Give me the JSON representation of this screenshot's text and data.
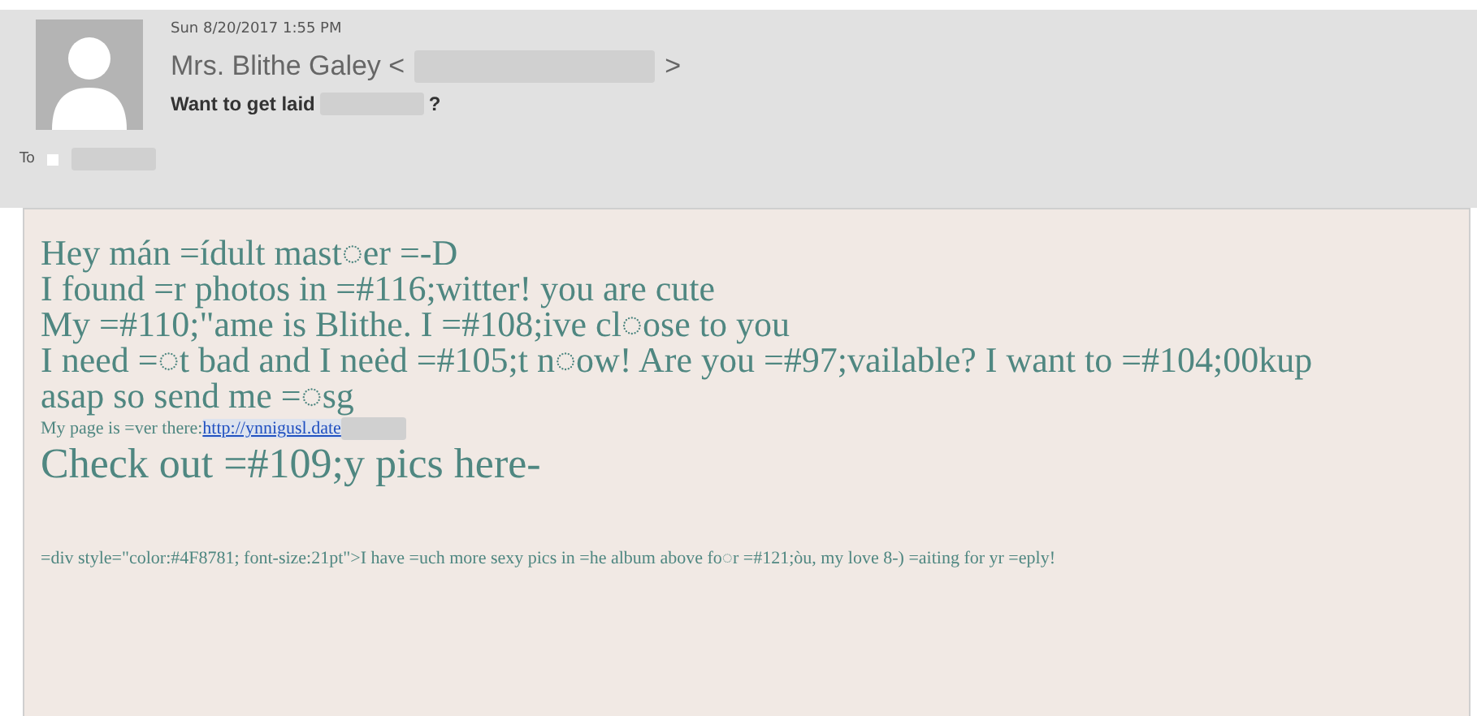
{
  "header": {
    "date": "Sun 8/20/2017 1:55 PM",
    "sender_name": "Mrs. Blithe Galey <",
    "sender_close": ">",
    "subject": "Want to get laid",
    "subject_end": "?",
    "to_label": "To"
  },
  "body": [
    {
      "kind": "large",
      "text": "Hey mán =ídult mast◌er =-D"
    },
    {
      "kind": "large",
      "text": "I found =r photos in =#116;witter! you are cute"
    },
    {
      "kind": "large",
      "text": "My =#110;\"ame is Blithe. I =#108;ive cl◌ose to you"
    },
    {
      "kind": "large",
      "text": "I need =◌t bad and I neėd =#105;t n◌ow! Are you =#97;vailable? I want to =#104;00kup asap so send me =◌sg"
    },
    {
      "kind": "small_link",
      "text": "My page is =ver there: ",
      "link": "http://ynnigusl.date"
    },
    {
      "kind": "xlarge",
      "text": "Check out =#109;y pics here-"
    },
    {
      "kind": "spacer"
    },
    {
      "kind": "small",
      "text": "=div style=\"color:#4F8781; font-size:21pt\">I have =uch more sexy pics in =he album above fo◌r =#121;òu, my love 8-) =aiting for yr =eply!"
    }
  ]
}
